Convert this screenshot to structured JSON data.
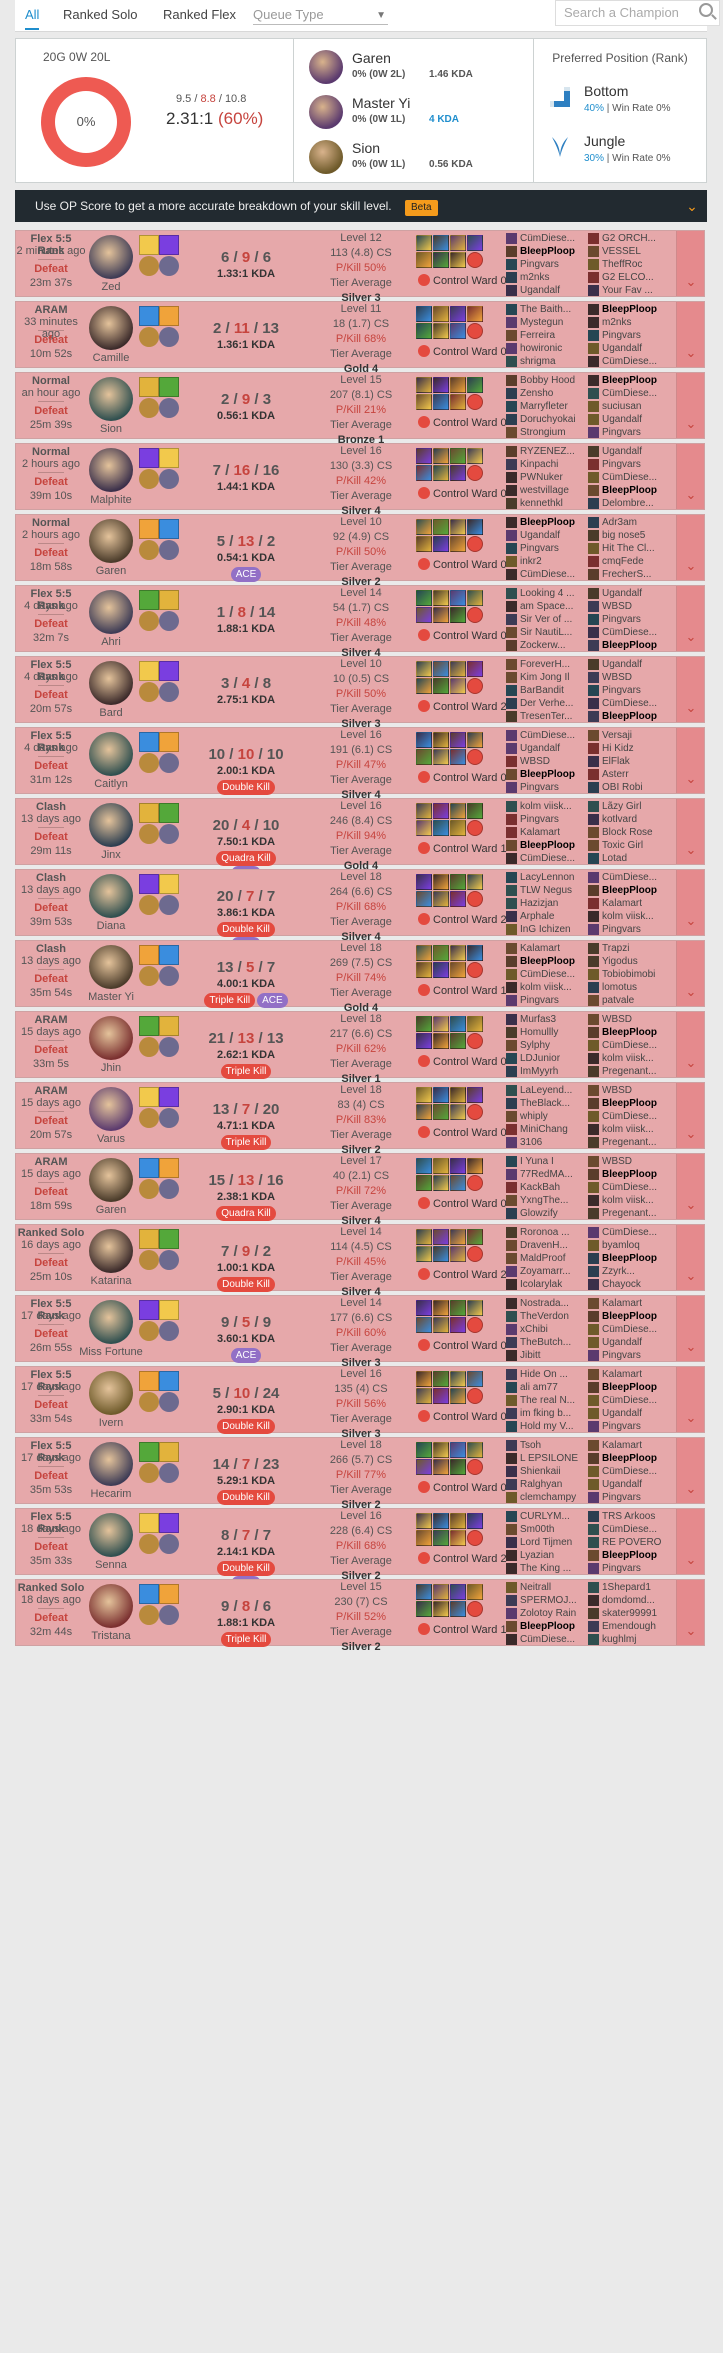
{
  "tabs": [
    "All",
    "Ranked Solo",
    "Ranked Flex"
  ],
  "queue_type": "Queue Type",
  "search_placeholder": "Search a Champion",
  "summary": {
    "record": "20G 0W 20L",
    "winrate": "0%",
    "kda_k": "9.5",
    "kda_d": "8.8",
    "kda_a": "10.8",
    "ratio": "2.31:1",
    "percent": "(60%)",
    "champions": [
      {
        "name": "Garen",
        "wl": "0% (0W 2L)",
        "kda": "1.46 KDA",
        "blue": false
      },
      {
        "name": "Master Yi",
        "wl": "0% (0W 1L)",
        "kda": "4 KDA",
        "blue": true
      },
      {
        "name": "Sion",
        "wl": "0% (0W 1L)",
        "kda": "0.56 KDA",
        "blue": false
      }
    ],
    "preferred_title": "Preferred Position (Rank)",
    "positions": [
      {
        "name": "Bottom",
        "pct": "40%",
        "wr": "Win Rate 0%"
      },
      {
        "name": "Jungle",
        "pct": "30%",
        "wr": "Win Rate 0%"
      }
    ]
  },
  "banner": {
    "text": "Use OP Score to get a more accurate breakdown of your skill level.",
    "beta": "Beta"
  },
  "labels": {
    "tier_avg": "Tier Average",
    "pkill": "P/Kill",
    "control_ward": "Control Ward"
  },
  "games": [
    {
      "type": "Flex 5:5 Rank",
      "time": "2 minutes ago",
      "result": "Defeat",
      "length": "23m 37s",
      "champ": "Zed",
      "k": "6",
      "d": "9",
      "a": "6",
      "ratio": "1.33:1 KDA",
      "badges": [],
      "level": "Level 12",
      "cs": "113 (4.8) CS",
      "pk": "P/Kill 50%",
      "tier": "Silver 3",
      "ward": "Control Ward 0",
      "team1": [
        "CümDiese...",
        "BleepPloop",
        "Pingvars",
        "m2nks",
        "Ugandalf"
      ],
      "team2": [
        "G2 ORCH...",
        "VESSEL",
        "TheffRoc",
        "G2 ELCO...",
        "Your Fav ..."
      ],
      "me1": 1,
      "me2": -1
    },
    {
      "type": "ARAM",
      "time": "33 minutes ago",
      "result": "Defeat",
      "length": "10m 52s",
      "champ": "Camille",
      "k": "2",
      "d": "11",
      "a": "13",
      "ratio": "1.36:1 KDA",
      "badges": [],
      "level": "Level 11",
      "cs": "18 (1.7) CS",
      "pk": "P/Kill 68%",
      "tier": "Gold 4",
      "ward": "Control Ward 0",
      "team1": [
        "The Baith...",
        "Mystegun",
        "Ferreira",
        "howironic",
        "shrigma"
      ],
      "team2": [
        "BleepPloop",
        "m2nks",
        "Pingvars",
        "Ugandalf",
        "CümDiese..."
      ],
      "me1": -1,
      "me2": 0
    },
    {
      "type": "Normal",
      "time": "an hour ago",
      "result": "Defeat",
      "length": "25m 39s",
      "champ": "Sion",
      "k": "2",
      "d": "9",
      "a": "3",
      "ratio": "0.56:1 KDA",
      "badges": [],
      "level": "Level 15",
      "cs": "207 (8.1) CS",
      "pk": "P/Kill 21%",
      "tier": "Bronze 1",
      "ward": "Control Ward 0",
      "team1": [
        "Bobby Hood",
        "Zensho",
        "Marryfleter",
        "Doruchyokai",
        "Strongium"
      ],
      "team2": [
        "BleepPloop",
        "CümDiese...",
        "suciusan",
        "Ugandalf",
        "Pingvars"
      ],
      "me1": -1,
      "me2": 0
    },
    {
      "type": "Normal",
      "time": "2 hours ago",
      "result": "Defeat",
      "length": "39m 10s",
      "champ": "Malphite",
      "k": "7",
      "d": "16",
      "a": "16",
      "ratio": "1.44:1 KDA",
      "badges": [],
      "level": "Level 16",
      "cs": "130 (3.3) CS",
      "pk": "P/Kill 42%",
      "tier": "Silver 4",
      "ward": "Control Ward 0",
      "team1": [
        "RYZENEZ...",
        "Kinpachi",
        "PWNuker",
        "westvillage",
        "kennethkl"
      ],
      "team2": [
        "Ugandalf",
        "Pingvars",
        "CümDiese...",
        "BleepPloop",
        "Delombre..."
      ],
      "me1": -1,
      "me2": 3
    },
    {
      "type": "Normal",
      "time": "2 hours ago",
      "result": "Defeat",
      "length": "18m 58s",
      "champ": "Garen",
      "k": "5",
      "d": "13",
      "a": "2",
      "ratio": "0.54:1 KDA",
      "badges": [
        "ACE"
      ],
      "level": "Level 10",
      "cs": "92 (4.9) CS",
      "pk": "P/Kill 50%",
      "tier": "Silver 2",
      "ward": "Control Ward 0",
      "team1": [
        "BleepPloop",
        "Ugandalf",
        "Pingvars",
        "inkr2",
        "CümDiese..."
      ],
      "team2": [
        "Adr3am",
        "big nose5",
        "Hit The Cl...",
        "cmqFede",
        "FrecherS..."
      ],
      "me1": 0,
      "me2": -1
    },
    {
      "type": "Flex 5:5 Rank",
      "time": "4 days ago",
      "result": "Defeat",
      "length": "32m 7s",
      "champ": "Ahri",
      "k": "1",
      "d": "8",
      "a": "14",
      "ratio": "1.88:1 KDA",
      "badges": [],
      "level": "Level 14",
      "cs": "54 (1.7) CS",
      "pk": "P/Kill 48%",
      "tier": "Silver 4",
      "ward": "Control Ward 0",
      "team1": [
        "Looking 4 ...",
        "am Space...",
        "Sir Ver of ...",
        "Sir NautiL...",
        "Zockerw..."
      ],
      "team2": [
        "Ugandalf",
        "WBSD",
        "Pingvars",
        "CümDiese...",
        "BleepPloop"
      ],
      "me1": -1,
      "me2": 4
    },
    {
      "type": "Flex 5:5 Rank",
      "time": "4 days ago",
      "result": "Defeat",
      "length": "20m 57s",
      "champ": "Bard",
      "k": "3",
      "d": "4",
      "a": "8",
      "ratio": "2.75:1 KDA",
      "badges": [],
      "level": "Level 10",
      "cs": "10 (0.5) CS",
      "pk": "P/Kill 50%",
      "tier": "Silver 3",
      "ward": "Control Ward 2",
      "team1": [
        "ForeverH...",
        "Kim Jong Il",
        "BarBandit",
        "Der Verhe...",
        "TresenTer..."
      ],
      "team2": [
        "Ugandalf",
        "WBSD",
        "Pingvars",
        "CümDiese...",
        "BleepPloop"
      ],
      "me1": -1,
      "me2": 4
    },
    {
      "type": "Flex 5:5 Rank",
      "time": "4 days ago",
      "result": "Defeat",
      "length": "31m 12s",
      "champ": "Caitlyn",
      "k": "10",
      "d": "10",
      "a": "10",
      "ratio": "2.00:1 KDA",
      "badges": [
        "Double Kill"
      ],
      "level": "Level 16",
      "cs": "191 (6.1) CS",
      "pk": "P/Kill 47%",
      "tier": "Silver 4",
      "ward": "Control Ward 0",
      "team1": [
        "CümDiese...",
        "Ugandalf",
        "WBSD",
        "BleepPloop",
        "Pingvars"
      ],
      "team2": [
        "Versaji",
        "Hi Kidz",
        "ElFlak",
        "Asterr",
        "OBI Robi"
      ],
      "me1": 3,
      "me2": -1
    },
    {
      "type": "Clash",
      "time": "13 days ago",
      "result": "Defeat",
      "length": "29m 11s",
      "champ": "Jinx",
      "k": "20",
      "d": "4",
      "a": "10",
      "ratio": "7.50:1 KDA",
      "badges": [
        "Quadra Kill",
        "ACE"
      ],
      "level": "Level 16",
      "cs": "246 (8.4) CS",
      "pk": "P/Kill 94%",
      "tier": "Gold 4",
      "ward": "Control Ward 1",
      "team1": [
        "kolm viisk...",
        "Pingvars",
        "Kalamart",
        "BleepPloop",
        "CümDiese..."
      ],
      "team2": [
        "Lãzy Girl",
        "kotlvard",
        "Block Rose",
        "Toxic Girl",
        "Lotad"
      ],
      "me1": 3,
      "me2": -1
    },
    {
      "type": "Clash",
      "time": "13 days ago",
      "result": "Defeat",
      "length": "39m 53s",
      "champ": "Diana",
      "k": "20",
      "d": "7",
      "a": "7",
      "ratio": "3.86:1 KDA",
      "badges": [
        "Double Kill",
        "ACE"
      ],
      "level": "Level 18",
      "cs": "264 (6.6) CS",
      "pk": "P/Kill 68%",
      "tier": "Silver 4",
      "ward": "Control Ward 2",
      "team1": [
        "LacyLennon",
        "TLW Negus",
        "Hazizjan",
        "Arphale",
        "InG Ichizen"
      ],
      "team2": [
        "CümDiese...",
        "BleepPloop",
        "Kalamart",
        "kolm viisk...",
        "Pingvars"
      ],
      "me1": -1,
      "me2": 1
    },
    {
      "type": "Clash",
      "time": "13 days ago",
      "result": "Defeat",
      "length": "35m 54s",
      "champ": "Master Yi",
      "k": "13",
      "d": "5",
      "a": "7",
      "ratio": "4.00:1 KDA",
      "badges": [
        "Triple Kill",
        "ACE"
      ],
      "level": "Level 18",
      "cs": "269 (7.5) CS",
      "pk": "P/Kill 74%",
      "tier": "Gold 4",
      "ward": "Control Ward 1",
      "team1": [
        "Kalamart",
        "BleepPloop",
        "CümDiese...",
        "kolm viisk...",
        "Pingvars"
      ],
      "team2": [
        "Trapzi",
        "Yigodus",
        "Tobiobimobi",
        "lomotus",
        "patvale"
      ],
      "me1": 1,
      "me2": -1
    },
    {
      "type": "ARAM",
      "time": "15 days ago",
      "result": "Defeat",
      "length": "33m 5s",
      "champ": "Jhin",
      "k": "21",
      "d": "13",
      "a": "13",
      "ratio": "2.62:1 KDA",
      "badges": [
        "Triple Kill"
      ],
      "level": "Level 18",
      "cs": "217 (6.6) CS",
      "pk": "P/Kill 62%",
      "tier": "Silver 1",
      "ward": "Control Ward 0",
      "team1": [
        "Murfas3",
        "Homullly",
        "Sylphy",
        "LDJunior",
        "ImMyyrh"
      ],
      "team2": [
        "WBSD",
        "BleepPloop",
        "CümDiese...",
        "kolm viisk...",
        "Pregenant..."
      ],
      "me1": -1,
      "me2": 1
    },
    {
      "type": "ARAM",
      "time": "15 days ago",
      "result": "Defeat",
      "length": "20m 57s",
      "champ": "Varus",
      "k": "13",
      "d": "7",
      "a": "20",
      "ratio": "4.71:1 KDA",
      "badges": [
        "Triple Kill"
      ],
      "level": "Level 18",
      "cs": "83 (4) CS",
      "pk": "P/Kill 83%",
      "tier": "Silver 2",
      "ward": "Control Ward 0",
      "team1": [
        "LaLeyend...",
        "TheBlack...",
        "whiply",
        "MiniChang",
        "3106"
      ],
      "team2": [
        "WBSD",
        "BleepPloop",
        "CümDiese...",
        "kolm viisk...",
        "Pregenant..."
      ],
      "me1": -1,
      "me2": 1
    },
    {
      "type": "ARAM",
      "time": "15 days ago",
      "result": "Defeat",
      "length": "18m 59s",
      "champ": "Garen",
      "k": "15",
      "d": "13",
      "a": "16",
      "ratio": "2.38:1 KDA",
      "badges": [
        "Quadra Kill"
      ],
      "level": "Level 17",
      "cs": "40 (2.1) CS",
      "pk": "P/Kill 72%",
      "tier": "Silver 4",
      "ward": "Control Ward 0",
      "team1": [
        "I Yuna I",
        "77RedMA...",
        "KackBah",
        "YxngThe...",
        "Glowzify"
      ],
      "team2": [
        "WBSD",
        "BleepPloop",
        "CümDiese...",
        "kolm viisk...",
        "Pregenant..."
      ],
      "me1": -1,
      "me2": 1
    },
    {
      "type": "Ranked Solo",
      "time": "16 days ago",
      "result": "Defeat",
      "length": "25m 10s",
      "champ": "Katarina",
      "k": "7",
      "d": "9",
      "a": "2",
      "ratio": "1.00:1 KDA",
      "badges": [
        "Double Kill"
      ],
      "level": "Level 14",
      "cs": "114 (4.5) CS",
      "pk": "P/Kill 45%",
      "tier": "Silver 4",
      "ward": "Control Ward 2",
      "team1": [
        "Roronoa ...",
        "DravenH...",
        "MaldProof",
        "Zoyamarr...",
        "Icolarylak"
      ],
      "team2": [
        "CümDiese...",
        "byamloq",
        "BleepPloop",
        "Zzyrk...",
        "Chayock"
      ],
      "me1": -1,
      "me2": 2
    },
    {
      "type": "Flex 5:5 Rank",
      "time": "17 days ago",
      "result": "Defeat",
      "length": "26m 55s",
      "champ": "Miss Fortune",
      "k": "9",
      "d": "5",
      "a": "9",
      "ratio": "3.60:1 KDA",
      "badges": [
        "ACE"
      ],
      "level": "Level 14",
      "cs": "177 (6.6) CS",
      "pk": "P/Kill 60%",
      "tier": "Silver 3",
      "ward": "Control Ward 0",
      "team1": [
        "Nostrada...",
        "TheVerdon",
        "xChibi",
        "TheButch...",
        "Jibitt"
      ],
      "team2": [
        "Kalamart",
        "BleepPloop",
        "CümDiese...",
        "Ugandalf",
        "Pingvars"
      ],
      "me1": -1,
      "me2": 1
    },
    {
      "type": "Flex 5:5 Rank",
      "time": "17 days ago",
      "result": "Defeat",
      "length": "33m 54s",
      "champ": "Ivern",
      "k": "5",
      "d": "10",
      "a": "24",
      "ratio": "2.90:1 KDA",
      "badges": [
        "Double Kill"
      ],
      "level": "Level 16",
      "cs": "135 (4) CS",
      "pk": "P/Kill 56%",
      "tier": "Silver 3",
      "ward": "Control Ward 0",
      "team1": [
        "Hide On ...",
        "ali am77",
        "The real N...",
        "im fking b...",
        "Hold my V..."
      ],
      "team2": [
        "Kalamart",
        "BleepPloop",
        "CümDiese...",
        "Ugandalf",
        "Pingvars"
      ],
      "me1": -1,
      "me2": 1
    },
    {
      "type": "Flex 5:5 Rank",
      "time": "17 days ago",
      "result": "Defeat",
      "length": "35m 53s",
      "champ": "Hecarim",
      "k": "14",
      "d": "7",
      "a": "23",
      "ratio": "5.29:1 KDA",
      "badges": [
        "Double Kill"
      ],
      "level": "Level 18",
      "cs": "266 (5.7) CS",
      "pk": "P/Kill 77%",
      "tier": "Silver 2",
      "ward": "Control Ward 0",
      "team1": [
        "Tsoh",
        "L EPSILONE",
        "Shienkaii",
        "Ralghyan",
        "clemchampy"
      ],
      "team2": [
        "Kalamart",
        "BleepPloop",
        "CümDiese...",
        "Ugandalf",
        "Pingvars"
      ],
      "me1": -1,
      "me2": 1
    },
    {
      "type": "Flex 5:5 Rank",
      "time": "18 days ago",
      "result": "Defeat",
      "length": "35m 33s",
      "champ": "Senna",
      "k": "8",
      "d": "7",
      "a": "7",
      "ratio": "2.14:1 KDA",
      "badges": [
        "Double Kill",
        "ACE"
      ],
      "level": "Level 16",
      "cs": "228 (6.4) CS",
      "pk": "P/Kill 68%",
      "tier": "Silver 2",
      "ward": "Control Ward 2",
      "team1": [
        "CURLYM...",
        "Sm00th",
        "Lord Tijmen",
        "Lyazian",
        "The King ..."
      ],
      "team2": [
        "TRS Arkoos",
        "CümDiese...",
        "RE POVERO",
        "BleepPloop",
        "Pingvars"
      ],
      "me1": -1,
      "me2": 3
    },
    {
      "type": "Ranked Solo",
      "time": "18 days ago",
      "result": "Defeat",
      "length": "32m 44s",
      "champ": "Tristana",
      "k": "9",
      "d": "8",
      "a": "6",
      "ratio": "1.88:1 KDA",
      "badges": [
        "Triple Kill"
      ],
      "level": "Level 15",
      "cs": "230 (7) CS",
      "pk": "P/Kill 52%",
      "tier": "Silver 2",
      "ward": "Control Ward 1",
      "team1": [
        "Neitrall",
        "SPERMOJ...",
        "Zolotoy Rain",
        "BleepPloop",
        "CümDiese..."
      ],
      "team2": [
        "1Shepard1",
        "domdomd...",
        "skater99991",
        "Emendough",
        "kughlmj"
      ],
      "me1": 3,
      "me2": -1
    }
  ],
  "colors": {
    "accent": "#1f8ecd",
    "defeat_bg": "#e6a8aa",
    "defeat_text": "#c6443e",
    "banner_bg": "#222a30",
    "beta": "#f59b1c"
  }
}
